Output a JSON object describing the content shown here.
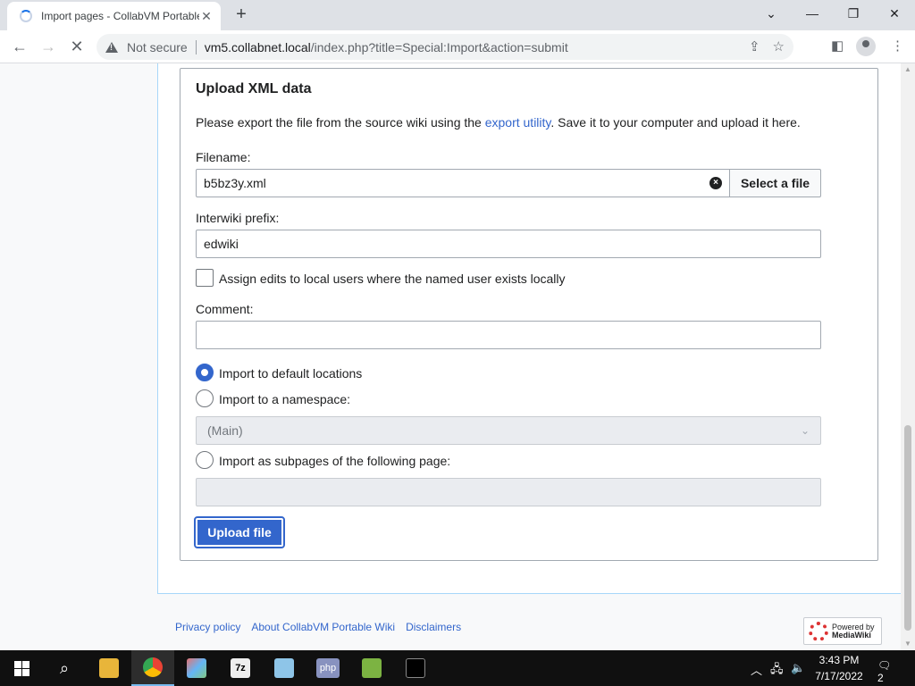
{
  "browser": {
    "tab_title": "Import pages - CollabVM Portable",
    "tab_close": "✕",
    "new_tab": "+",
    "not_secure": "Not secure",
    "url_host": "vm5.collabnet.local",
    "url_path": "/index.php?title=Special:Import&action=submit"
  },
  "form": {
    "legend": "Upload XML data",
    "intro_before": "Please export the file from the source wiki using the ",
    "intro_link": "export utility",
    "intro_after": ". Save it to your computer and upload it here.",
    "filename_label": "Filename:",
    "filename_value": "b5bz3y.xml",
    "select_file_label": "Select a file",
    "interwiki_label": "Interwiki prefix:",
    "interwiki_value": "edwiki",
    "assign_edits_label": "Assign edits to local users where the named user exists locally",
    "comment_label": "Comment:",
    "comment_value": "",
    "radio_default": "Import to default locations",
    "radio_namespace": "Import to a namespace:",
    "namespace_selected": "(Main)",
    "radio_subpages": "Import as subpages of the following page:",
    "subpage_value": "",
    "upload_label": "Upload file"
  },
  "footer": {
    "privacy": "Privacy policy",
    "about": "About CollabVM Portable Wiki",
    "disclaimers": "Disclaimers",
    "powered_line1": "Powered by",
    "powered_line2": "MediaWiki"
  },
  "taskbar": {
    "time": "3:43 PM",
    "date": "7/17/2022",
    "notifications": "2",
    "apps": [
      "start-icon",
      "search-icon",
      "file-explorer-icon",
      "chrome-icon",
      "paint-icon",
      "7zip-icon",
      "notepad-icon",
      "php-icon",
      "notepadpp-icon",
      "terminal-icon"
    ],
    "php_label": "php",
    "sevenzip_label": "7z"
  },
  "colors": {
    "link": "#3366cc",
    "primary_button": "#3366cc",
    "taskbar": "#101010",
    "chrome_tabstrip": "#dee1e6"
  }
}
